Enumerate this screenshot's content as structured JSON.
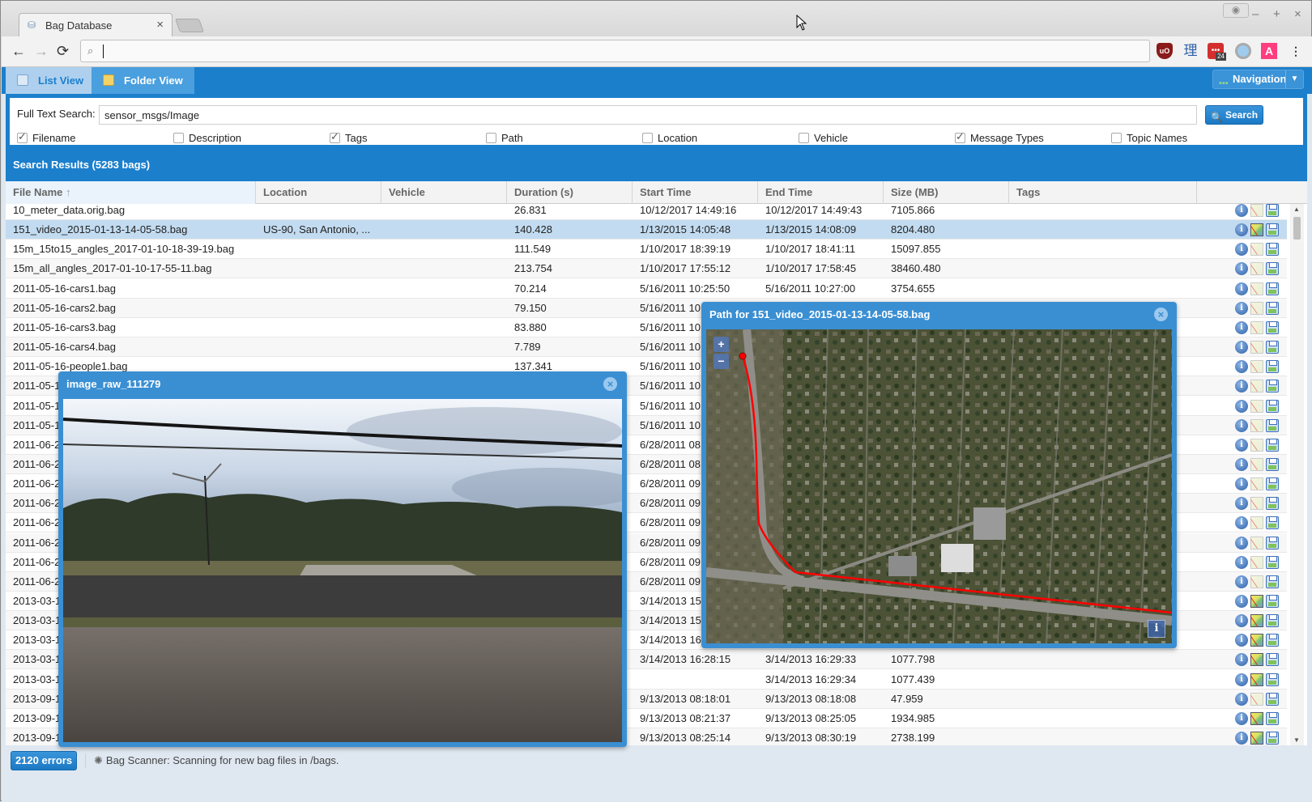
{
  "browser": {
    "tab_title": "Bag Database",
    "tab_close": "×",
    "address_value": "",
    "ext_badge_count": "24",
    "window_controls": {
      "minimize": "–",
      "maximize": "+",
      "close": "×"
    },
    "nav": {
      "back": "←",
      "forward": "→",
      "reload": "⟳"
    },
    "menu_icon": "⋮"
  },
  "app": {
    "view_tabs": [
      {
        "label": "List View",
        "active": true
      },
      {
        "label": "Folder View",
        "active": false
      }
    ],
    "navigation_button": "Navigation",
    "search": {
      "label": "Full Text Search:",
      "value": "sensor_msgs/Image",
      "button": "Search",
      "options": [
        {
          "label": "Filename",
          "checked": true
        },
        {
          "label": "Description",
          "checked": false
        },
        {
          "label": "Tags",
          "checked": true
        },
        {
          "label": "Path",
          "checked": false
        },
        {
          "label": "Location",
          "checked": false
        },
        {
          "label": "Vehicle",
          "checked": false
        },
        {
          "label": "Message Types",
          "checked": true
        },
        {
          "label": "Topic Names",
          "checked": false
        }
      ]
    },
    "results_title": "Search Results (5283 bags)",
    "columns": [
      "File Name",
      "Location",
      "Vehicle",
      "Duration (s)",
      "Start Time",
      "End Time",
      "Size (MB)",
      "Tags"
    ],
    "sort_indicator": "↑",
    "rows": [
      {
        "file": "10_meter_data.orig.bag",
        "location": "",
        "vehicle": "",
        "duration": "26.831",
        "start": "10/12/2017 14:49:16",
        "end": "10/12/2017 14:49:43",
        "size": "7105.866",
        "tags": "",
        "has_path": false
      },
      {
        "file": "151_video_2015-01-13-14-05-58.bag",
        "location": "US-90, San Antonio, ...",
        "vehicle": "",
        "duration": "140.428",
        "start": "1/13/2015 14:05:48",
        "end": "1/13/2015 14:08:09",
        "size": "8204.480",
        "tags": "",
        "has_path": true,
        "selected": true
      },
      {
        "file": "15m_15to15_angles_2017-01-10-18-39-19.bag",
        "location": "",
        "vehicle": "",
        "duration": "111.549",
        "start": "1/10/2017 18:39:19",
        "end": "1/10/2017 18:41:11",
        "size": "15097.855",
        "tags": "",
        "has_path": false
      },
      {
        "file": "15m_all_angles_2017-01-10-17-55-11.bag",
        "location": "",
        "vehicle": "",
        "duration": "213.754",
        "start": "1/10/2017 17:55:12",
        "end": "1/10/2017 17:58:45",
        "size": "38460.480",
        "tags": "",
        "has_path": false
      },
      {
        "file": "2011-05-16-cars1.bag",
        "location": "",
        "vehicle": "",
        "duration": "70.214",
        "start": "5/16/2011 10:25:50",
        "end": "5/16/2011 10:27:00",
        "size": "3754.655",
        "tags": "",
        "has_path": false
      },
      {
        "file": "2011-05-16-cars2.bag",
        "location": "",
        "vehicle": "",
        "duration": "79.150",
        "start": "5/16/2011 10:",
        "end": "",
        "size": "",
        "tags": "",
        "has_path": false
      },
      {
        "file": "2011-05-16-cars3.bag",
        "location": "",
        "vehicle": "",
        "duration": "83.880",
        "start": "5/16/2011 10:",
        "end": "",
        "size": "",
        "tags": "",
        "has_path": false
      },
      {
        "file": "2011-05-16-cars4.bag",
        "location": "",
        "vehicle": "",
        "duration": "7.789",
        "start": "5/16/2011 10:",
        "end": "",
        "size": "",
        "tags": "",
        "has_path": false
      },
      {
        "file": "2011-05-16-people1.bag",
        "location": "",
        "vehicle": "",
        "duration": "137.341",
        "start": "5/16/2011 10:",
        "end": "",
        "size": "",
        "tags": "",
        "has_path": false
      },
      {
        "file": "2011-05-1",
        "location": "",
        "vehicle": "",
        "duration": "",
        "start": "5/16/2011 10:",
        "end": "",
        "size": "",
        "tags": "",
        "has_path": false
      },
      {
        "file": "2011-05-1",
        "location": "",
        "vehicle": "",
        "duration": "",
        "start": "5/16/2011 10:",
        "end": "",
        "size": "",
        "tags": "",
        "has_path": false
      },
      {
        "file": "2011-05-1",
        "location": "",
        "vehicle": "",
        "duration": "",
        "start": "5/16/2011 10:",
        "end": "",
        "size": "",
        "tags": "",
        "has_path": false
      },
      {
        "file": "2011-06-2",
        "location": "",
        "vehicle": "",
        "duration": "",
        "start": "6/28/2011 08:",
        "end": "",
        "size": "",
        "tags": "",
        "has_path": false
      },
      {
        "file": "2011-06-2",
        "location": "",
        "vehicle": "",
        "duration": "",
        "start": "6/28/2011 08:",
        "end": "",
        "size": "",
        "tags": "",
        "has_path": false
      },
      {
        "file": "2011-06-2",
        "location": "",
        "vehicle": "",
        "duration": "",
        "start": "6/28/2011 09:",
        "end": "",
        "size": "",
        "tags": "",
        "has_path": false
      },
      {
        "file": "2011-06-2",
        "location": "",
        "vehicle": "",
        "duration": "",
        "start": "6/28/2011 09:",
        "end": "",
        "size": "",
        "tags": "",
        "has_path": false
      },
      {
        "file": "2011-06-2",
        "location": "",
        "vehicle": "",
        "duration": "",
        "start": "6/28/2011 09:",
        "end": "",
        "size": "",
        "tags": "",
        "has_path": false
      },
      {
        "file": "2011-06-2",
        "location": "",
        "vehicle": "",
        "duration": "",
        "start": "6/28/2011 09:",
        "end": "",
        "size": "",
        "tags": "",
        "has_path": false
      },
      {
        "file": "2011-06-2",
        "location": "",
        "vehicle": "",
        "duration": "",
        "start": "6/28/2011 09:",
        "end": "",
        "size": "",
        "tags": "",
        "has_path": false
      },
      {
        "file": "2011-06-2",
        "location": "",
        "vehicle": "",
        "duration": "",
        "start": "6/28/2011 09:",
        "end": "",
        "size": "",
        "tags": "",
        "has_path": false
      },
      {
        "file": "2013-03-1",
        "location": "",
        "vehicle": "",
        "duration": "",
        "start": "3/14/2013 15:",
        "end": "",
        "size": "",
        "tags": "",
        "has_path": true
      },
      {
        "file": "2013-03-1",
        "location": "",
        "vehicle": "",
        "duration": "",
        "start": "3/14/2013 15:",
        "end": "",
        "size": "",
        "tags": "",
        "has_path": true
      },
      {
        "file": "2013-03-1",
        "location": "",
        "vehicle": "",
        "duration": "",
        "start": "3/14/2013 16:",
        "end": "",
        "size": "",
        "tags": "",
        "has_path": true
      },
      {
        "file": "2013-03-1",
        "location": "",
        "vehicle": "",
        "duration": "",
        "start": "3/14/2013 16:28:15",
        "end": "3/14/2013 16:29:33",
        "size": "1077.798",
        "tags": "",
        "has_path": true
      },
      {
        "file": "2013-03-1",
        "location": "",
        "vehicle": "",
        "duration": "",
        "start": "",
        "end": "3/14/2013 16:29:34",
        "size": "1077.439",
        "tags": "",
        "has_path": true
      },
      {
        "file": "2013-09-1",
        "location": "",
        "vehicle": "",
        "duration": "",
        "start": "9/13/2013 08:18:01",
        "end": "9/13/2013 08:18:08",
        "size": "47.959",
        "tags": "",
        "has_path": false
      },
      {
        "file": "2013-09-1",
        "location": "",
        "vehicle": "",
        "duration": "",
        "start": "9/13/2013 08:21:37",
        "end": "9/13/2013 08:25:05",
        "size": "1934.985",
        "tags": "",
        "has_path": true
      },
      {
        "file": "2013-09-1",
        "location": "",
        "vehicle": "",
        "duration": "",
        "start": "9/13/2013 08:25:14",
        "end": "9/13/2013 08:30:19",
        "size": "2738.199",
        "tags": "",
        "has_path": true
      }
    ],
    "status": {
      "errors_button": "2120 errors",
      "scanner_text": "Bag Scanner: Scanning for new bag files in /bags."
    },
    "image_window": {
      "title": "image_raw_111279",
      "close": "×"
    },
    "map_window": {
      "title": "Path for 151_video_2015-01-13-14-05-58.bag",
      "close": "×",
      "zoom_in": "+",
      "zoom_out": "−",
      "attribution": "i",
      "path_color": "#ff0000"
    }
  }
}
